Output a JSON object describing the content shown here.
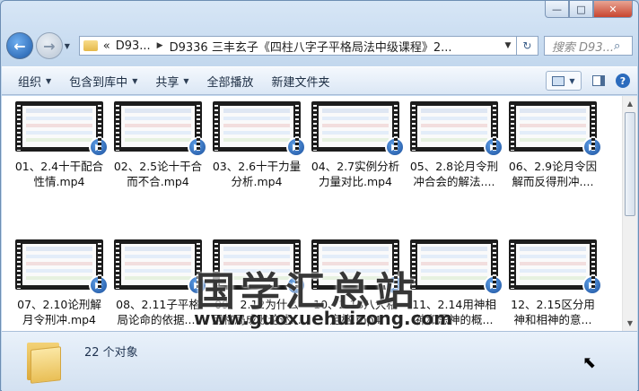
{
  "window": {
    "caption": {
      "minimize": "—",
      "maximize": "□",
      "close": "✕"
    }
  },
  "nav": {
    "back_glyph": "←",
    "forward_glyph": "→",
    "address": {
      "prefix": "«",
      "crumb1": "D93...",
      "crumb2": "D9336 三丰玄子《四柱八字子平格局法中级课程》2...",
      "icon": "folder-icon"
    },
    "search_placeholder": "搜索 D93...",
    "refresh_glyph": "↻",
    "search_glyph": "⌕"
  },
  "toolbar": {
    "organize": "组织",
    "include_library": "包含到库中",
    "share": "共享",
    "play_all": "全部播放",
    "new_folder": "新建文件夹",
    "help": "?"
  },
  "files": [
    {
      "name": "01、2.4十干配合性情.mp4"
    },
    {
      "name": "02、2.5论十干合而不合.mp4"
    },
    {
      "name": "03、2.6十干力量分析.mp4"
    },
    {
      "name": "04、2.7实例分析力量对比.mp4"
    },
    {
      "name": "05、2.8论月令刑冲合会的解法...."
    },
    {
      "name": "06、2.9论月令因解而反得刑冲...."
    },
    {
      "name": "07、2.10论刑解月令刑冲.mp4"
    },
    {
      "name": "08、2.11子平格局论命的依据...."
    },
    {
      "name": "09、2.12为什么用格局成败论述..."
    },
    {
      "name": "10、2.13八大格定格.mp4"
    },
    {
      "name": "11、2.14用神相神和忌神的概..."
    },
    {
      "name": "12、2.15区分用神和相神的意..."
    }
  ],
  "watermark": {
    "title": "国学汇总站",
    "url": "www.guoxuehuizong.com"
  },
  "status": {
    "count_text": "22 个对象"
  },
  "colors": {
    "accent": "#1d5aa8",
    "toolbar_bg": "#dbe7f5",
    "frame": "#c3d8ee"
  }
}
